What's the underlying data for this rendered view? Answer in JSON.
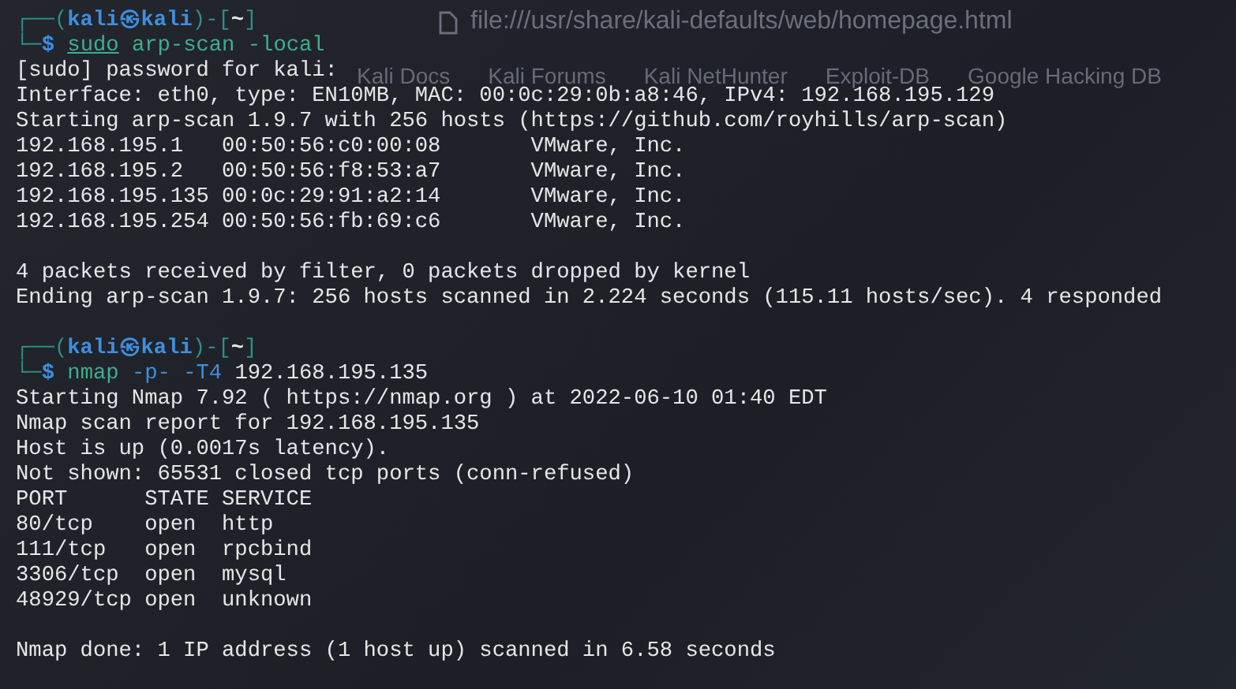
{
  "background_browser": {
    "url": "file:///usr/share/kali-defaults/web/homepage.html",
    "bookmarks": [
      "Kali Docs",
      "Kali Forums",
      "Kali NetHunter",
      "Exploit-DB",
      "Google Hacking DB"
    ]
  },
  "terminal": {
    "lines": [
      {
        "kind": "prompt",
        "segments": [
          {
            "kind": "frame",
            "text": "┌──("
          },
          {
            "kind": "user",
            "text": "kali㉿kali"
          },
          {
            "kind": "frame",
            "text": ")-["
          },
          {
            "kind": "dir",
            "text": "~"
          },
          {
            "kind": "frame",
            "text": "]"
          }
        ]
      },
      {
        "kind": "command",
        "segments": [
          {
            "kind": "frame",
            "text": "└─"
          },
          {
            "kind": "symbol",
            "text": "$ "
          },
          {
            "kind": "sudo",
            "text": "sudo"
          },
          {
            "kind": "cmd",
            "text": " arp-scan -local"
          }
        ]
      },
      {
        "kind": "output",
        "text": "[sudo] password for kali:"
      },
      {
        "kind": "output",
        "text": "Interface: eth0, type: EN10MB, MAC: 00:0c:29:0b:a8:46, IPv4: 192.168.195.129"
      },
      {
        "kind": "output",
        "text": "Starting arp-scan 1.9.7 with 256 hosts (https://github.com/royhills/arp-scan)"
      },
      {
        "kind": "output",
        "text": "192.168.195.1   00:50:56:c0:00:08       VMware, Inc."
      },
      {
        "kind": "output",
        "text": "192.168.195.2   00:50:56:f8:53:a7       VMware, Inc."
      },
      {
        "kind": "output",
        "text": "192.168.195.135 00:0c:29:91:a2:14       VMware, Inc."
      },
      {
        "kind": "output",
        "text": "192.168.195.254 00:50:56:fb:69:c6       VMware, Inc."
      },
      {
        "kind": "blank"
      },
      {
        "kind": "output",
        "text": "4 packets received by filter, 0 packets dropped by kernel"
      },
      {
        "kind": "output",
        "text": "Ending arp-scan 1.9.7: 256 hosts scanned in 2.224 seconds (115.11 hosts/sec). 4 responded"
      },
      {
        "kind": "blank"
      },
      {
        "kind": "prompt",
        "segments": [
          {
            "kind": "frame",
            "text": "┌──("
          },
          {
            "kind": "user",
            "text": "kali㉿kali"
          },
          {
            "kind": "frame",
            "text": ")-["
          },
          {
            "kind": "dir",
            "text": "~"
          },
          {
            "kind": "frame",
            "text": "]"
          }
        ]
      },
      {
        "kind": "command",
        "segments": [
          {
            "kind": "frame",
            "text": "└─"
          },
          {
            "kind": "symbol",
            "text": "$ "
          },
          {
            "kind": "cmd",
            "text": "nmap"
          },
          {
            "kind": "option",
            "text": " -p- -T4"
          },
          {
            "kind": "value",
            "text": " 192.168.195.135"
          }
        ]
      },
      {
        "kind": "output",
        "text": "Starting Nmap 7.92 ( https://nmap.org ) at 2022-06-10 01:40 EDT"
      },
      {
        "kind": "output",
        "text": "Nmap scan report for 192.168.195.135"
      },
      {
        "kind": "output",
        "text": "Host is up (0.0017s latency)."
      },
      {
        "kind": "output",
        "text": "Not shown: 65531 closed tcp ports (conn-refused)"
      },
      {
        "kind": "output",
        "text": "PORT      STATE SERVICE"
      },
      {
        "kind": "output",
        "text": "80/tcp    open  http"
      },
      {
        "kind": "output",
        "text": "111/tcp   open  rpcbind"
      },
      {
        "kind": "output",
        "text": "3306/tcp  open  mysql"
      },
      {
        "kind": "output",
        "text": "48929/tcp open  unknown"
      },
      {
        "kind": "blank"
      },
      {
        "kind": "output",
        "text": "Nmap done: 1 IP address (1 host up) scanned in 6.58 seconds"
      }
    ]
  }
}
